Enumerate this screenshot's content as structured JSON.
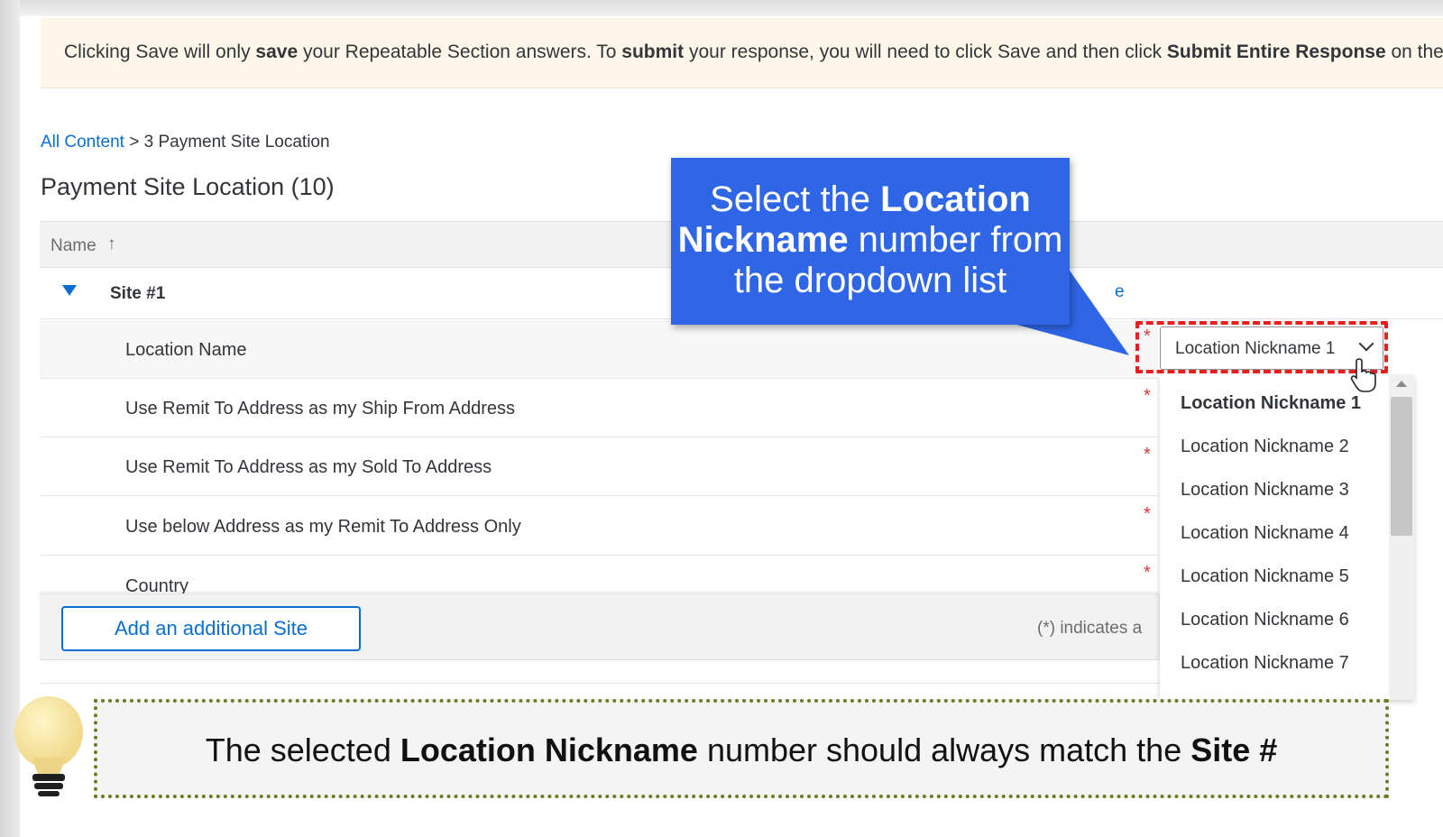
{
  "banner": {
    "p1": "Clicking Save will only ",
    "b1": "save",
    "p2": " your Repeatable Section answers. To ",
    "b2": "submit",
    "p3": " your response, you will need to click Save and then click ",
    "b3": "Submit Entire Response",
    "p4": " on the"
  },
  "breadcrumb": {
    "link": "All Content",
    "sep": " > ",
    "current": "3 Payment Site Location"
  },
  "page_title": "Payment Site Location (10)",
  "table": {
    "header_label": "Name",
    "sort_icon": "↑",
    "site_label": "Site #1",
    "ghost_text": "e",
    "rows": [
      {
        "label": "Location Name"
      },
      {
        "label": "Use Remit To Address as my Ship From Address"
      },
      {
        "label": "Use Remit To Address as my Sold To Address"
      },
      {
        "label": "Use below Address as my Remit To Address Only"
      },
      {
        "label": "Country"
      }
    ],
    "required_marker": "*"
  },
  "footer": {
    "add_button": "Add an additional Site",
    "required_note": "(*) indicates a"
  },
  "select": {
    "value": "Location Nickname 1",
    "options": [
      "Location Nickname 1",
      "Location Nickname 2",
      "Location Nickname 3",
      "Location Nickname 4",
      "Location Nickname 5",
      "Location Nickname 6",
      "Location Nickname 7"
    ]
  },
  "callout": {
    "p1": "Select the ",
    "b1": "Location Nickname",
    "p2": " number from the dropdown list"
  },
  "tip": {
    "p1": "The selected ",
    "b1": "Location Nickname",
    "p2": " number should always match the ",
    "b2": "Site #"
  },
  "colors": {
    "accent": "#0a6ed1",
    "callout": "#2f66e8",
    "highlight": "#e8201c",
    "tip_border": "#6b7b22",
    "required": "#d9363e"
  }
}
